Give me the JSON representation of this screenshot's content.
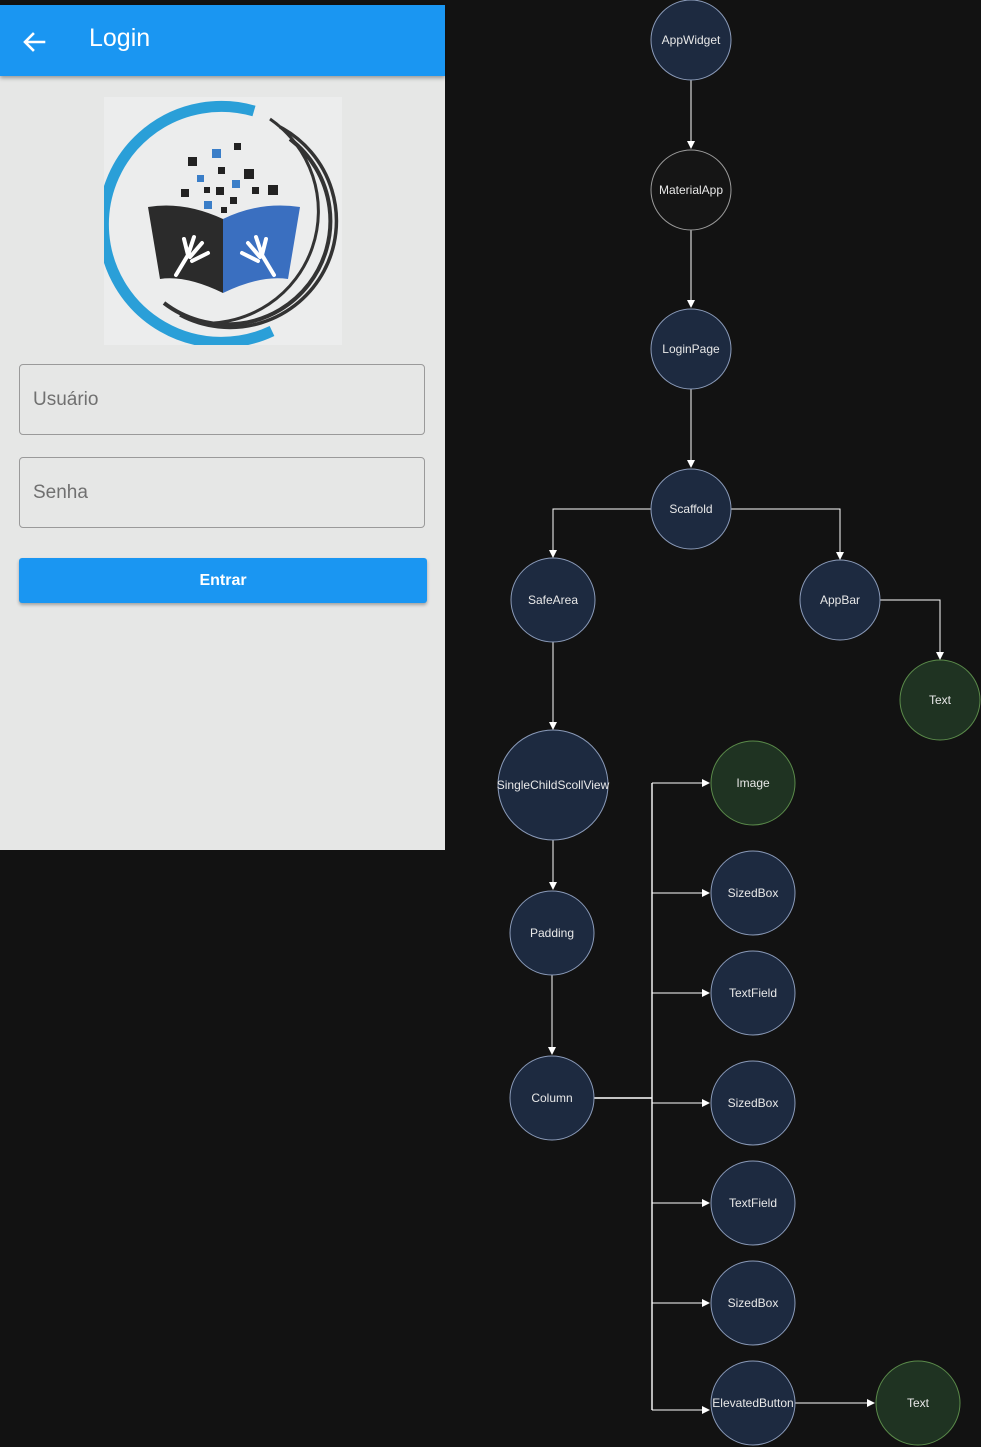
{
  "phone": {
    "appbar": {
      "title": "Login",
      "back_icon": "arrow-left-icon"
    },
    "logo": {
      "icon": "book-logo-icon"
    },
    "username_field": {
      "placeholder": "Usuário",
      "value": ""
    },
    "password_field": {
      "placeholder": "Senha",
      "value": ""
    },
    "login_button": {
      "label": "Entrar"
    },
    "colors": {
      "primary": "#1a96f2",
      "background": "#e6e7e6"
    }
  },
  "tree": {
    "colors": {
      "node_fill": "#1d2a40",
      "leaf_fill": "#1f3322",
      "edge": "#ffffff",
      "background": "#121212"
    },
    "nodes": {
      "appwidget": "AppWidget",
      "materialapp": "MaterialApp",
      "loginpage": "LoginPage",
      "scaffold": "Scaffold",
      "safearea": "SafeArea",
      "appbar": "AppBar",
      "appbar_text": "Text",
      "scrollview": "SingleChildScollView",
      "padding": "Padding",
      "column": "Column",
      "image": "Image",
      "sizedbox1": "SizedBox",
      "textfield1": "TextField",
      "sizedbox2": "SizedBox",
      "textfield2": "TextField",
      "sizedbox3": "SizedBox",
      "elevatedbutton": "ElevatedButton",
      "button_text": "Text"
    }
  }
}
